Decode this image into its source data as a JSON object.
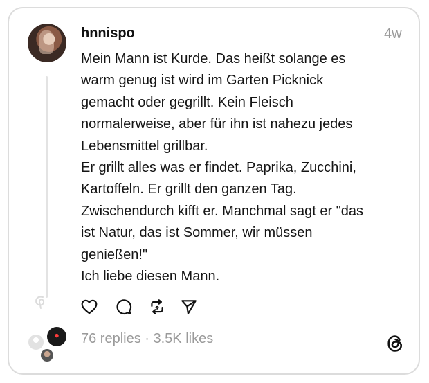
{
  "post": {
    "username": "hnnispo",
    "timestamp": "4w",
    "lines": [
      "Mein Mann ist Kurde. Das heißt solange es",
      "warm genug ist wird im Garten Picknick",
      "gemacht oder gegrillt. Kein Fleisch",
      "normalerweise, aber für ihn ist nahezu jedes",
      "Lebensmittel grillbar.",
      "Er grillt alles was er findet. Paprika, Zucchini,",
      "Kartoffeln. Er grillt den ganzen Tag.",
      "Zwischendurch kifft er. Manchmal sagt er \"das",
      "ist Natur, das ist Sommer, wir müssen",
      "genießen!\"",
      "Ich liebe diesen Mann."
    ]
  },
  "actions": {
    "like": "heart-icon",
    "reply": "comment-icon",
    "repost": "repost-icon",
    "share": "send-icon"
  },
  "footer": {
    "stats": "76 replies · 3.5K likes",
    "logo": "threads-icon"
  },
  "colors": {
    "text": "#151515",
    "muted": "#9a9a9a",
    "border": "#dcdcdc"
  }
}
